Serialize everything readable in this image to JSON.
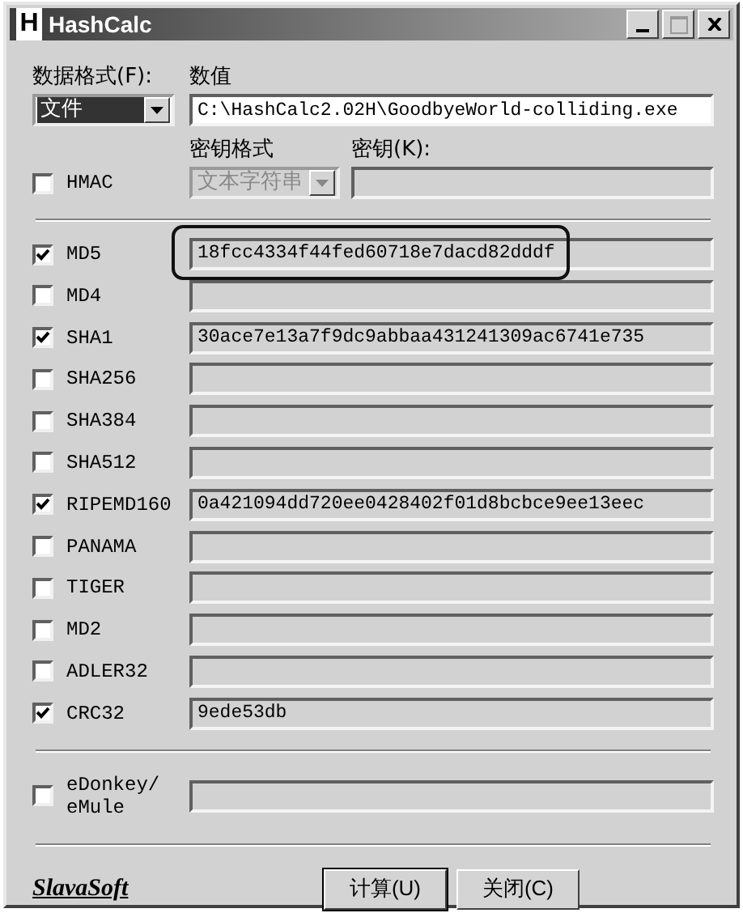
{
  "window": {
    "title": "HashCalc",
    "title_icon": "H"
  },
  "data_format": {
    "label": "数据格式(F):",
    "value": "文件"
  },
  "data_value": {
    "label": "数值",
    "value": "C:\\HashCalc2.02H\\GoodbyeWorld-colliding.exe"
  },
  "hmac": {
    "label": "HMAC",
    "checked": false
  },
  "key_format": {
    "label": "密钥格式",
    "value": "文本字符串",
    "disabled": true
  },
  "key": {
    "label": "密钥(K):"
  },
  "algorithms": [
    {
      "label": "MD5",
      "checked": true,
      "value": "18fcc4334f44fed60718e7dacd82dddf",
      "highlighted": true
    },
    {
      "label": "MD4",
      "checked": false,
      "highlighted": false
    },
    {
      "label": "SHA1",
      "checked": true,
      "value": "30ace7e13a7f9dc9abbaa431241309ac6741e735",
      "highlighted": false
    },
    {
      "label": "SHA256",
      "checked": false,
      "highlighted": false
    },
    {
      "label": "SHA384",
      "checked": false,
      "highlighted": false
    },
    {
      "label": "SHA512",
      "checked": false,
      "highlighted": false
    },
    {
      "label": "RIPEMD160",
      "checked": true,
      "value": "0a421094dd720ee0428402f01d8bcbce9ee13eec",
      "highlighted": false
    },
    {
      "label": "PANAMA",
      "checked": false,
      "highlighted": false
    },
    {
      "label": "TIGER",
      "checked": false,
      "highlighted": false
    },
    {
      "label": "MD2",
      "checked": false,
      "highlighted": false
    },
    {
      "label": "ADLER32",
      "checked": false,
      "highlighted": false
    },
    {
      "label": "CRC32",
      "checked": true,
      "value": "9ede53db",
      "highlighted": false
    }
  ],
  "edonkey": {
    "label": "eDonkey/\neMule",
    "checked": false
  },
  "logo": "SlavaSoft",
  "buttons": [
    "计算(U)",
    "关闭(C)"
  ]
}
